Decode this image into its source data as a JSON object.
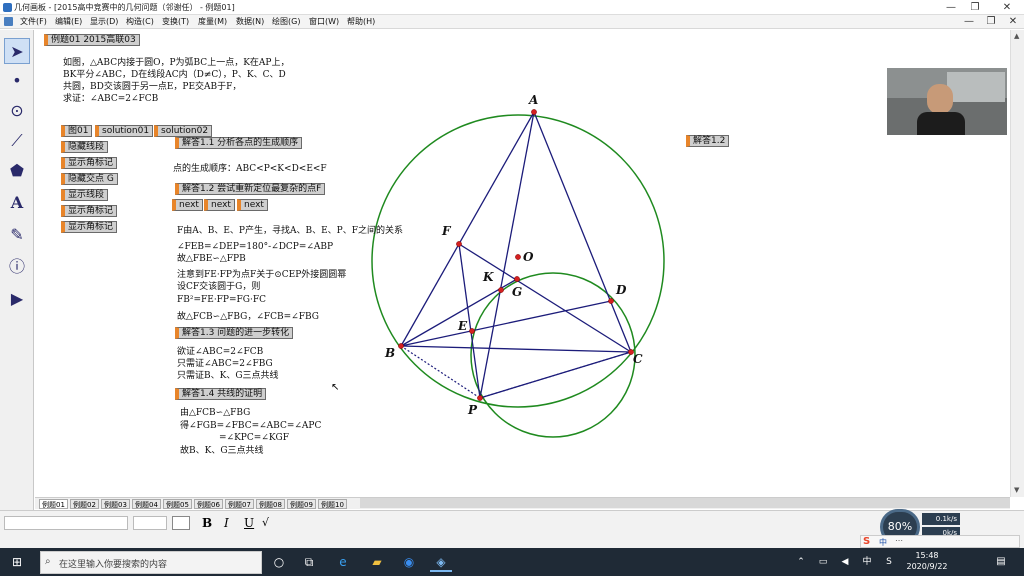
{
  "window": {
    "title": "几何画板 - [2015高中竞赛中的几何问题（邻谢任） - 例题01]",
    "min": "—",
    "max": "❐",
    "close": "✕",
    "inner_min": "—",
    "inner_max": "❐",
    "inner_close": "✕"
  },
  "menu": [
    "文件(F)",
    "编辑(E)",
    "显示(D)",
    "构造(C)",
    "变换(T)",
    "度量(M)",
    "数据(N)",
    "绘图(G)",
    "窗口(W)",
    "帮助(H)"
  ],
  "tools": [
    "arrow-tool",
    "point-tool",
    "compass-tool",
    "line-tool",
    "polygon-tool",
    "text-tool",
    "marker-tool",
    "info-tool",
    "custom-tool"
  ],
  "canvas": {
    "title_btn": "例题01 2015高联03",
    "problem_lines": [
      "如图，△ABC内接于圆O，P为弧BC上一点，K在AP上，",
      "BK平分∠ABC，D在线段AC内（D≠C），P、K、C、D",
      "共圆，BD交该圆于另一点E，PE交AB于F，",
      "求证：∠ABC=2∠FCB"
    ],
    "fig_btns": [
      "图01",
      "solution01",
      "solution02"
    ],
    "left_btns": [
      "隐藏线段",
      "显示角标记",
      "隐藏交点 G",
      "显示线段",
      "显示角标记",
      "显示角标记"
    ],
    "ans11": "解答1.1 分析各点的生成顺序",
    "order_text": "点的生成顺序：ABC<P<K<D<E<F",
    "ans12": "解答1.2 尝试重新定位最复杂的点F",
    "next_btns": [
      "next",
      "next",
      "next"
    ],
    "block2": [
      "F由A、B、E、P产生，寻找A、B、E、P、F之间的关系",
      "∠FEB=∠DEP=180°-∠DCP=∠ABP",
      "故△FBE∽△FPB",
      "注意到FE·FP为点F关于⊙CEP外接圆圆幂",
      "设CF交该圆于G，则",
      "FB²=FE·FP=FG·FC",
      "故△FCB∽△FBG，∠FCB=∠FBG"
    ],
    "ans13": "解答1.3 问题的进一步转化",
    "block3": [
      "欲证∠ABC=2∠FCB",
      "只需证∠ABC=2∠FBG",
      "只需证B、K、G三点共线"
    ],
    "ans14": "解答1.4 共线的证明",
    "block4": [
      "由△FCB∽△FBG",
      "得∠FGB=∠FBC=∠ABC=∠APC",
      "=∠KPC=∠KGF",
      "故B、K、G三点共线"
    ],
    "right_btn": "解答1.2",
    "point_labels": {
      "A": "A",
      "B": "B",
      "C": "C",
      "D": "D",
      "E": "E",
      "F": "F",
      "G": "G",
      "K": "K",
      "O": "O",
      "P": "P"
    }
  },
  "page_tabs": [
    "例题01",
    "例题02",
    "例题03",
    "例题04",
    "例题05",
    "例题06",
    "例题07",
    "例题08",
    "例题09",
    "例题10"
  ],
  "format_bar": {
    "bold": "B",
    "italic": "I",
    "underline": "U"
  },
  "taskbar": {
    "search_placeholder": "在这里输入你要搜索的内容",
    "time": "15:48",
    "date": "2020/9/22",
    "ime": "中",
    "battery": "80%",
    "net_up": "0.1k/s",
    "net_down": "0k/s"
  },
  "colors": {
    "accent_btn": "#e8852a",
    "circle": "#1f8a1f",
    "lines": "#1c1c7a",
    "points": "#d42020"
  }
}
